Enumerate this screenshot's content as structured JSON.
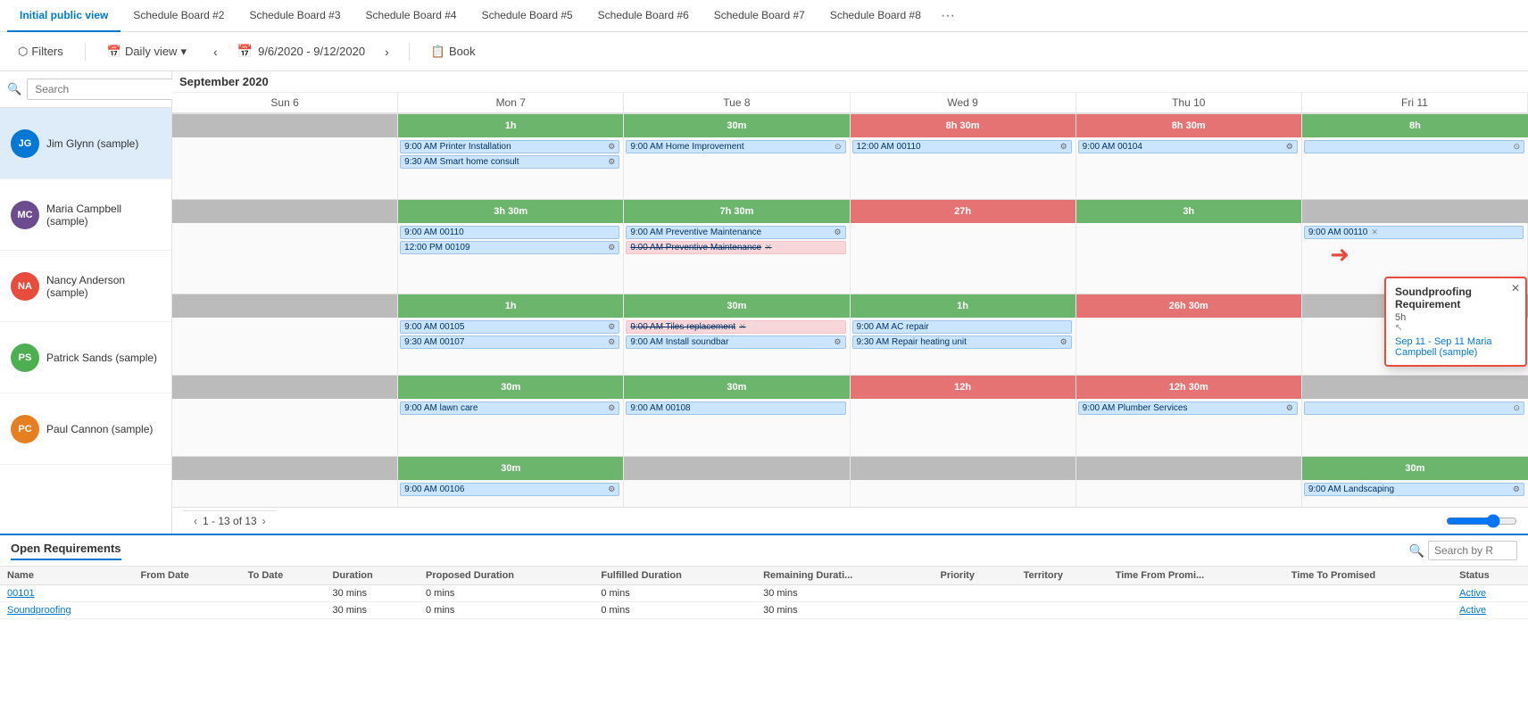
{
  "tabs": [
    {
      "label": "Initial public view",
      "active": true
    },
    {
      "label": "Schedule Board #2"
    },
    {
      "label": "Schedule Board #3"
    },
    {
      "label": "Schedule Board #4"
    },
    {
      "label": "Schedule Board #5"
    },
    {
      "label": "Schedule Board #6"
    },
    {
      "label": "Schedule Board #7"
    },
    {
      "label": "Schedule Board #8"
    }
  ],
  "toolbar": {
    "filters_label": "Filters",
    "view_label": "Daily view",
    "date_range": "9/6/2020 - 9/12/2020",
    "book_label": "Book"
  },
  "sidebar": {
    "search_placeholder": "Search",
    "resources": [
      {
        "initials": "JG",
        "name": "Jim Glynn (sample)",
        "color": "#0078d4",
        "selected": true
      },
      {
        "initials": "MC",
        "name": "Maria Campbell (sample)",
        "color": "#6c4b8e"
      },
      {
        "initials": "NA",
        "name": "Nancy Anderson (sample)",
        "color": "#e74c3c"
      },
      {
        "initials": "PS",
        "name": "Patrick Sands (sample)",
        "color": "#4caf50"
      },
      {
        "initials": "PC",
        "name": "Paul Cannon (sample)",
        "color": "#e67e22"
      }
    ]
  },
  "calendar": {
    "month": "September 2020",
    "days": [
      {
        "label": "Sun 6"
      },
      {
        "label": "Mon 7"
      },
      {
        "label": "Tue 8"
      },
      {
        "label": "Wed 9"
      },
      {
        "label": "Thu 10"
      },
      {
        "label": "Fri 11"
      }
    ]
  },
  "popover": {
    "title": "Soundproofing Requirement",
    "detail": "5h",
    "date": "Sep 11 - Sep 11 Maria Campbell (sample)"
  },
  "bottom": {
    "title": "Open Requirements",
    "search_placeholder": "Search by R",
    "columns": [
      "Name",
      "From Date",
      "To Date",
      "Duration",
      "Proposed Duration",
      "Fulfilled Duration",
      "Remaining Durati...",
      "Priority",
      "Territory",
      "Time From Promi...",
      "Time To Promised",
      "Status"
    ],
    "rows": [
      {
        "name": "00101",
        "from_date": "",
        "to_date": "",
        "duration": "30 mins",
        "proposed": "0 mins",
        "fulfilled": "0 mins",
        "remaining": "30 mins",
        "priority": "",
        "territory": "",
        "time_from": "",
        "time_to": "",
        "status": "Active"
      },
      {
        "name": "Soundproofing",
        "from_date": "",
        "to_date": "",
        "duration": "30 mins",
        "proposed": "0 mins",
        "fulfilled": "0 mins",
        "remaining": "30 mins",
        "priority": "",
        "territory": "",
        "time_from": "",
        "time_to": "",
        "status": "Active"
      }
    ]
  },
  "pagination": {
    "text": "1 - 13 of 13"
  }
}
